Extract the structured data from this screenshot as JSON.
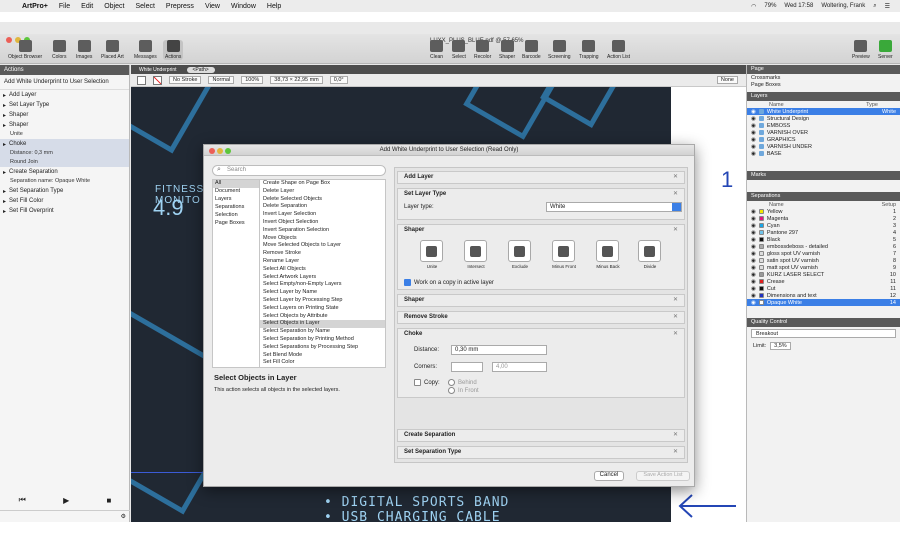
{
  "menubar": {
    "app_name": "ArtPro+",
    "items": [
      "File",
      "Edit",
      "Object",
      "Select",
      "Prepress",
      "View",
      "Window",
      "Help"
    ],
    "battery": "79%",
    "clock": "Wed 17:58",
    "user": "Woltering, Frank"
  },
  "toolbar": {
    "document_title": "LUXX_PLUS_BLUE.pdf @ 57,65%",
    "left_buttons": [
      "Object Browser",
      "Colors",
      "Images",
      "Placed Art",
      "Messages",
      "Actions"
    ],
    "center_buttons": [
      "Clean",
      "Select",
      "Recolor",
      "Shaper",
      "Barcode",
      "Screening",
      "Trapping",
      "Action List"
    ],
    "right_buttons": [
      "Preview",
      "Server"
    ]
  },
  "actions_panel": {
    "header": "Actions",
    "subtitle": "Add White Underprint to User Selection",
    "rows": [
      {
        "label": "Add Layer",
        "selected": false,
        "subs": []
      },
      {
        "label": "Set Layer Type",
        "selected": false,
        "subs": []
      },
      {
        "label": "Shaper",
        "selected": false,
        "subs": []
      },
      {
        "label": "Shaper",
        "selected": false,
        "subs": [
          "Unite"
        ]
      },
      {
        "label": "Choke",
        "selected": true,
        "subs": [
          "Distance: 0,3 mm",
          "Round Join"
        ]
      },
      {
        "label": "Create Separation",
        "selected": false,
        "subs": [
          "Separation name: Opaque White"
        ]
      },
      {
        "label": "Set Separation Type",
        "selected": false,
        "subs": []
      },
      {
        "label": "Set Fill Color",
        "selected": false,
        "subs": []
      },
      {
        "label": "Set Fill Overprint",
        "selected": false,
        "subs": []
      }
    ]
  },
  "tabstrip": {
    "tab": "White Underprint",
    "path": "<Path>"
  },
  "ctrlbar": {
    "stroke": "No Stroke",
    "blend": "Normal",
    "opacity": "100%",
    "size": "38,73 × 22,95 mm",
    "angle": "0,0°",
    "view": "None"
  },
  "canvas": {
    "fitness": "FITNESS",
    "monitor": "MONITO",
    "number": "4.9",
    "lines": [
      "• DIGITAL SPORTS BAND",
      "• USB CHARGING CABLE"
    ],
    "annotation": "1"
  },
  "dialog": {
    "title": "Add White Underprint to User Selection (Read Only)",
    "search_placeholder": "Search",
    "categories": [
      "All",
      "Document",
      "Layers",
      "Separations",
      "Selection",
      "Page Boxes"
    ],
    "selected_category": "All",
    "actions": [
      "Create Shape on Page Box",
      "Delete Layer",
      "Delete Selected Objects",
      "Delete Separation",
      "Invert Layer Selection",
      "Invert Object Selection",
      "Invert Separation Selection",
      "Move Objects",
      "Move Selected Objects to Layer",
      "Remove Stroke",
      "Rename Layer",
      "Select All Objects",
      "Select Artwork Layers",
      "Select Empty/non-Empty Layers",
      "Select Layer by Name",
      "Select Layer by Processing Step",
      "Select Layers on Printing State",
      "Select Objects by Attribute",
      "Select Objects in Layer",
      "Select Separation by Name",
      "Select Separation by Printing Method",
      "Select Separations by Processing Step",
      "Set Blend Mode",
      "Set Fill Color",
      "Set Fill Overprint"
    ],
    "selected_action": "Select Objects in Layer",
    "desc_title": "Select Objects in Layer",
    "desc": "This action selects all objects in the selected layers.",
    "sections": {
      "add_layer": "Add Layer",
      "set_layer_type": "Set Layer Type",
      "layer_type_label": "Layer type:",
      "layer_type_value": "White",
      "shaper": "Shaper",
      "shaper_ops": [
        "Unite",
        "Intersect",
        "Exclude",
        "Minus Front",
        "Minus Back",
        "Divide"
      ],
      "work_on_copy": "Work on a copy in active layer",
      "shaper2": "Shaper",
      "remove_stroke": "Remove Stroke",
      "choke": "Choke",
      "distance_label": "Distance:",
      "distance_value": "0,30 mm",
      "corners_label": "Corners:",
      "corner_value": "4,00",
      "copy_label": "Copy:",
      "behind": "Behind",
      "in_front": "In Front",
      "create_separation": "Create Separation",
      "set_separation_type": "Set Separation Type",
      "set_fill_color": "Set Fill Color"
    },
    "cancel": "Cancel",
    "save": "Save Action List"
  },
  "right_panel": {
    "page_header": "Page",
    "page_rows": [
      "Crossmarks",
      "Page Boxes"
    ],
    "layers_header": "Layers",
    "layers_cols": [
      "Name",
      "Type"
    ],
    "layers": [
      {
        "name": "White Underprint",
        "type": "White",
        "selected": true
      },
      {
        "name": "Structural Design",
        "type": "",
        "selected": false
      },
      {
        "name": "EMBOSS",
        "type": "",
        "selected": false
      },
      {
        "name": "VARNISH OVER",
        "type": "",
        "selected": false
      },
      {
        "name": "GRAPHICS",
        "type": "",
        "selected": false
      },
      {
        "name": "VARNISH UNDER",
        "type": "",
        "selected": false
      },
      {
        "name": "BASE",
        "type": "",
        "selected": false
      }
    ],
    "marks_header": "Marks",
    "separations_header": "Separations",
    "separations_cols": [
      "Name",
      "Setup"
    ],
    "separations": [
      {
        "name": "Yellow",
        "num": "1",
        "color": "#f2e600",
        "selected": false
      },
      {
        "name": "Magenta",
        "num": "2",
        "color": "#e0177e",
        "selected": false
      },
      {
        "name": "Cyan",
        "num": "3",
        "color": "#19a5e6",
        "selected": false
      },
      {
        "name": "Pantone 297",
        "num": "4",
        "color": "#6fc3ea",
        "selected": false
      },
      {
        "name": "Black",
        "num": "5",
        "color": "#111111",
        "selected": false
      },
      {
        "name": "embossdeboss - detailed",
        "num": "6",
        "color": "#aaaaaa",
        "selected": false
      },
      {
        "name": "gloss spot UV varnish",
        "num": "7",
        "color": "#dddddd",
        "selected": false
      },
      {
        "name": "satin spot UV varnish",
        "num": "8",
        "color": "#dddddd",
        "selected": false
      },
      {
        "name": "matt spot UV varnish",
        "num": "9",
        "color": "#dddddd",
        "selected": false
      },
      {
        "name": "KURZ LASER SELECT",
        "num": "10",
        "color": "#999999",
        "selected": false
      },
      {
        "name": "Crease",
        "num": "11",
        "color": "#e02020",
        "selected": false
      },
      {
        "name": "Cut",
        "num": "11",
        "color": "#111111",
        "selected": false
      },
      {
        "name": "Dimensions and text",
        "num": "12",
        "color": "#2030c0",
        "selected": false
      },
      {
        "name": "Opaque White",
        "num": "14",
        "color": "#ffffff",
        "selected": true
      }
    ],
    "quality_header": "Quality Control",
    "quality_value": "Breakout",
    "limit_label": "Limit:",
    "limit_value": "3,5%"
  }
}
